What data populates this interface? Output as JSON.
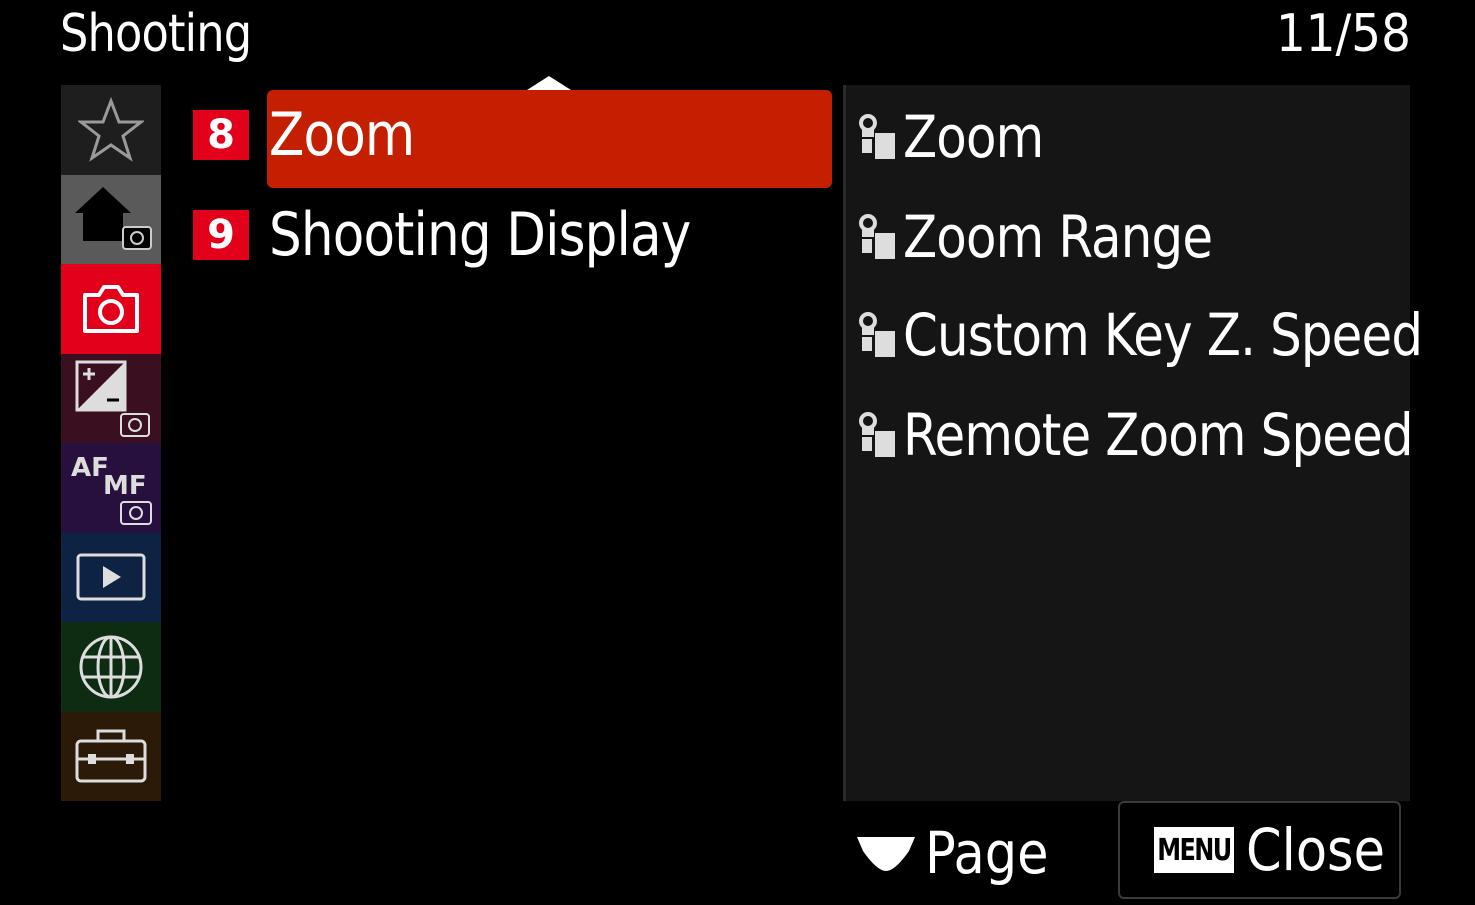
{
  "header": {
    "title": "Shooting",
    "page_count": "11/58"
  },
  "sidebar": {
    "items": [
      {
        "icon": "star-icon"
      },
      {
        "icon": "home-camera-icon"
      },
      {
        "icon": "camera-icon"
      },
      {
        "icon": "exposure-camera-icon"
      },
      {
        "icon": "af-mf-camera-icon",
        "label_af": "AF",
        "label_mf": "MF"
      },
      {
        "icon": "playback-icon"
      },
      {
        "icon": "globe-icon"
      },
      {
        "icon": "toolbox-icon"
      }
    ]
  },
  "middle": {
    "items": [
      {
        "number": "8",
        "label": "Zoom",
        "selected": true
      },
      {
        "number": "9",
        "label": "Shooting Display",
        "selected": false
      }
    ]
  },
  "right": {
    "items": [
      {
        "icon": "custom-zoom-icon",
        "label": "Zoom"
      },
      {
        "icon": "custom-zoom-icon",
        "label": "Zoom Range"
      },
      {
        "icon": "custom-zoom-icon",
        "label": "Custom Key Z. Speed"
      },
      {
        "icon": "custom-zoom-icon",
        "label": "Remote Zoom Speed"
      }
    ]
  },
  "footer": {
    "page_label": "Page",
    "menu_badge": "MENU",
    "close_label": "Close"
  },
  "colors": {
    "accent_red": "#e2001a",
    "selected_bg": "#c41f00"
  }
}
